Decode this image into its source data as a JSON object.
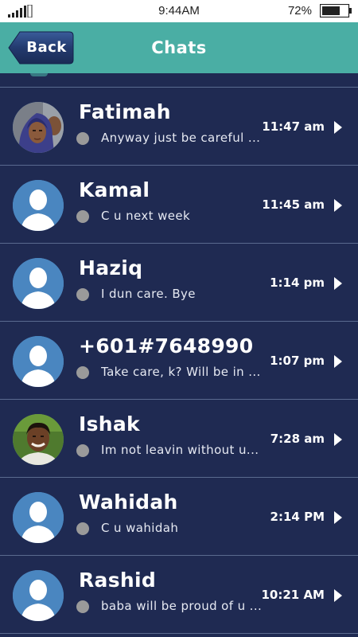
{
  "status_bar": {
    "time": "9:44AM",
    "battery_percent": "72%",
    "battery_level": 0.72,
    "signal_bars": 4
  },
  "header": {
    "back_label": "Back",
    "title": "Chats",
    "color": "#4aaea4"
  },
  "chats": [
    {
      "name": "Fatimah",
      "message": "Anyway just be careful ...",
      "time": "11:47 am",
      "avatar": "photo-woman-hijab-icon"
    },
    {
      "name": "Kamal",
      "message": "C u next week",
      "time": "11:45 am",
      "avatar": "default-person-icon"
    },
    {
      "name": "Haziq",
      "message": "I dun care. Bye",
      "time": "1:14 pm",
      "avatar": "default-person-icon"
    },
    {
      "name": "+601#7648990",
      "message": "Take care, k? Will be in ...",
      "time": "1:07 pm",
      "avatar": "default-person-icon"
    },
    {
      "name": "Ishak",
      "message": "Im not leavin without u...",
      "time": "7:28 am",
      "avatar": "photo-young-man-icon"
    },
    {
      "name": "Wahidah",
      "message": "C u wahidah",
      "time": "2:14 PM",
      "avatar": "default-person-icon"
    },
    {
      "name": "Rashid",
      "message": "baba will be proud of u ...",
      "time": "10:21 AM",
      "avatar": "default-person-icon"
    }
  ],
  "colors": {
    "background": "#1f2a52",
    "avatar_default": "#4a86c0",
    "presence_offline": "#9a9a9a"
  }
}
